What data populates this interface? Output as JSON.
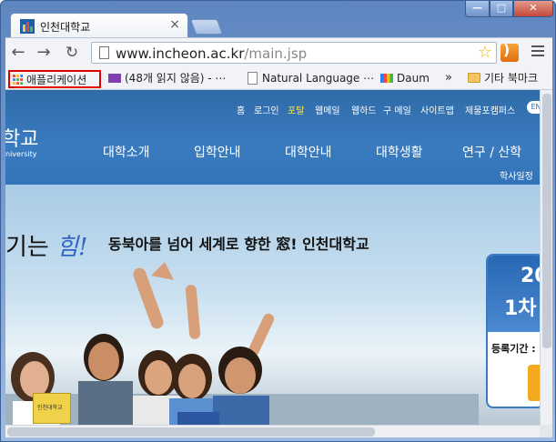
{
  "browser": {
    "tab_title": "인천대학교",
    "tab_close": "×",
    "window_buttons": {
      "minimize": "—",
      "maximize": "□",
      "close": "✕"
    },
    "url_host": "www.incheon.ac.kr",
    "url_path": "/main.jsp",
    "nav": {
      "back": "←",
      "forward": "→",
      "reload": "↻"
    },
    "star": "☆"
  },
  "bookmarks": {
    "apps": "애플리케이션",
    "mail": "(48개 읽지 않음) - ⋯",
    "natural_language": "Natural Language ⋯",
    "daum": "Daum",
    "more": "»",
    "other": "기타 북마크"
  },
  "site": {
    "logo": "학교",
    "logo_sub": "niversity",
    "util_links": [
      "홈",
      "로그인",
      "포탈",
      "웹메일",
      "웹하드",
      "구 메일",
      "사이트맵",
      "제물포캠퍼스"
    ],
    "en_badge": "EN",
    "gnb": [
      "대학소개",
      "입학안내",
      "대학안내",
      "대학생활",
      "연구 / 산학"
    ],
    "sub_link": "학사일정",
    "slogan_hand_a": "기는 ",
    "slogan_hand_b": "힘!",
    "slogan": "동북아를 넘어 세계로 향한 窓! 인천대학교",
    "book_label": "인천대학교"
  },
  "popup": {
    "year": "20",
    "round": "1차",
    "period": "등록기간 :"
  },
  "colors": {
    "header": "#3274b8",
    "active_link": "#fde54a",
    "highlight": "#e00000"
  }
}
